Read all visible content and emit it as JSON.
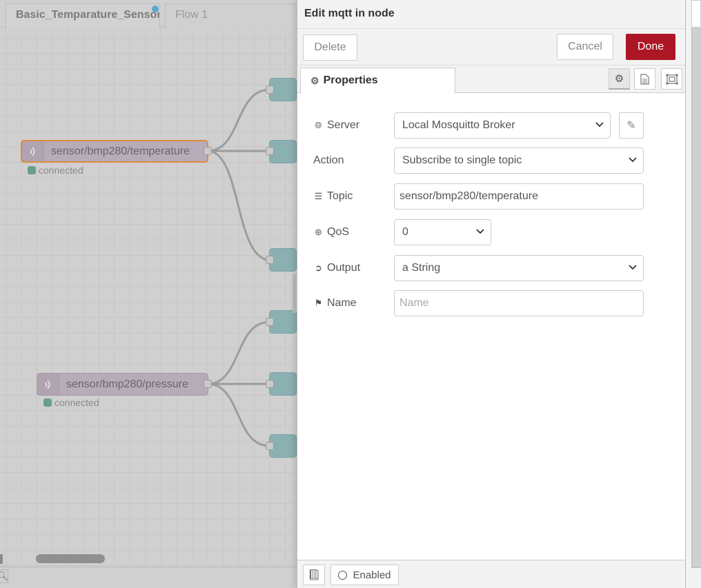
{
  "workspace": {
    "tabs": [
      {
        "label": "Basic_Temparature_Sensor",
        "active": true,
        "changed": true
      },
      {
        "label": "Flow 1",
        "active": false
      }
    ],
    "nodes": [
      {
        "label": "sensor/bmp280/temperature",
        "status": "connected",
        "selected": true,
        "icon": "mqtt-wifi-icon"
      },
      {
        "label": "sensor/bmp280/pressure",
        "status": "connected",
        "selected": false,
        "icon": "mqtt-wifi-icon"
      }
    ],
    "status_color": "#6a9f8a",
    "node_color": "#b8abb9",
    "target_node_color": "#8ab0b2"
  },
  "tray": {
    "title": "Edit mqtt in node",
    "buttons": {
      "delete": "Delete",
      "cancel": "Cancel",
      "done": "Done"
    },
    "done_color": "#ad1625",
    "tabs": {
      "properties": "Properties"
    },
    "form": {
      "server": {
        "label": "Server",
        "value": "Local Mosquitto Broker"
      },
      "action": {
        "label": "Action",
        "value": "Subscribe to single topic"
      },
      "topic": {
        "label": "Topic",
        "value": "sensor/bmp280/temperature"
      },
      "qos": {
        "label": "QoS",
        "value": "0"
      },
      "output": {
        "label": "Output",
        "value": "a String"
      },
      "name": {
        "label": "Name",
        "value": "",
        "placeholder": "Name"
      }
    },
    "footer": {
      "enabled_label": "Enabled"
    }
  }
}
